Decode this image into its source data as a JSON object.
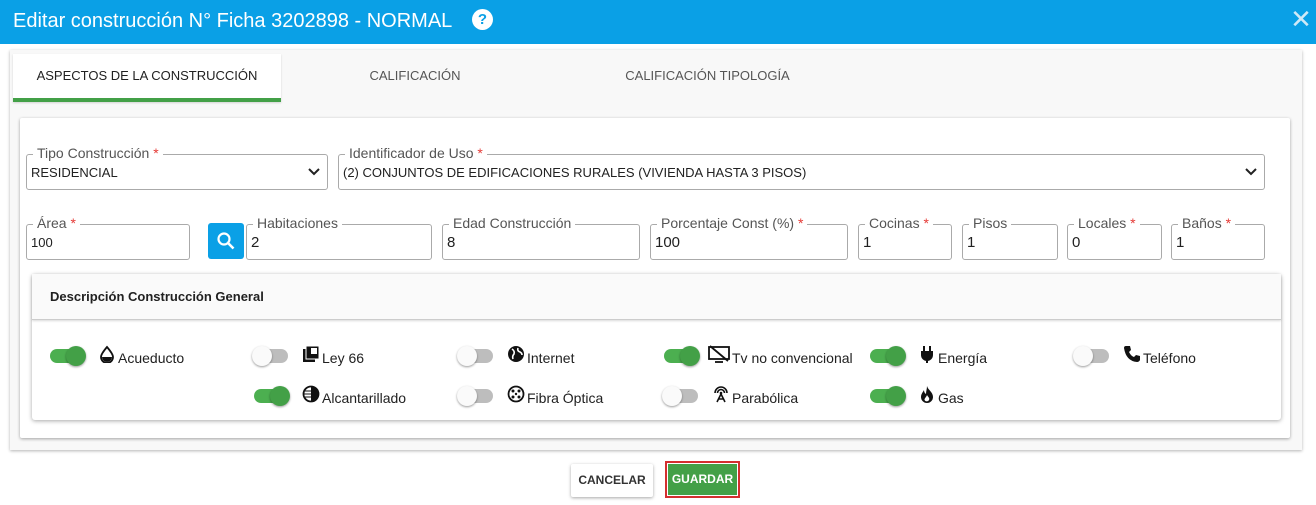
{
  "dialog": {
    "title": "Editar construcción N° Ficha 3202898 - NORMAL",
    "help_glyph": "?",
    "close_glyph": "✕"
  },
  "tabs": [
    {
      "label": "ASPECTOS DE LA CONSTRUCCIÓN",
      "active": true
    },
    {
      "label": "CALIFICACIÓN",
      "active": false
    },
    {
      "label": "CALIFICACIÓN TIPOLOGÍA",
      "active": false
    }
  ],
  "required_mark": "*",
  "fields": {
    "tipo_construccion": {
      "label": "Tipo Construcción",
      "value": "RESIDENCIAL",
      "required": true
    },
    "identificador_uso": {
      "label": "Identificador de Uso",
      "value": "(2) CONJUNTOS DE EDIFICACIONES RURALES (VIVIENDA HASTA 3 PISOS)",
      "required": true
    },
    "area": {
      "label": "Área",
      "value": "100",
      "required": true
    },
    "habitaciones": {
      "label": "Habitaciones",
      "value": "2",
      "required": false
    },
    "edad_construccion": {
      "label": "Edad Construcción",
      "value": "8",
      "required": false
    },
    "porcentaje_const": {
      "label": "Porcentaje Const (%)",
      "value": "100",
      "required": true
    },
    "cocinas": {
      "label": "Cocinas",
      "value": "1",
      "required": true
    },
    "pisos": {
      "label": "Pisos",
      "value": "1",
      "required": false
    },
    "locales": {
      "label": "Locales",
      "value": "0",
      "required": true
    },
    "banos": {
      "label": "Baños",
      "value": "1",
      "required": true
    }
  },
  "description": {
    "title": "Descripción Construcción General",
    "services": [
      {
        "label": "Acueducto",
        "on": true,
        "icon": "water-drop-icon"
      },
      {
        "label": "Ley 66",
        "on": false,
        "icon": "library-icon"
      },
      {
        "label": "Internet",
        "on": false,
        "icon": "globe-icon"
      },
      {
        "label": "Tv no convencional",
        "on": true,
        "icon": "tv-off-icon"
      },
      {
        "label": "Energía",
        "on": true,
        "icon": "plug-icon"
      },
      {
        "label": "Teléfono",
        "on": false,
        "icon": "phone-icon"
      },
      {
        "label": "Alcantarillado",
        "on": true,
        "icon": "contrast-icon"
      },
      {
        "label": "Fibra Óptica",
        "on": false,
        "icon": "connector-icon"
      },
      {
        "label": "Parabólica",
        "on": false,
        "icon": "antenna-icon"
      },
      {
        "label": "Gas",
        "on": true,
        "icon": "flame-icon"
      }
    ]
  },
  "actions": {
    "cancel_label": "CANCELAR",
    "save_label": "GUARDAR"
  },
  "colors": {
    "header": "#0aa0e6",
    "accent_green": "#43a047",
    "required": "#e53935",
    "highlight_border": "#d32f2f"
  }
}
